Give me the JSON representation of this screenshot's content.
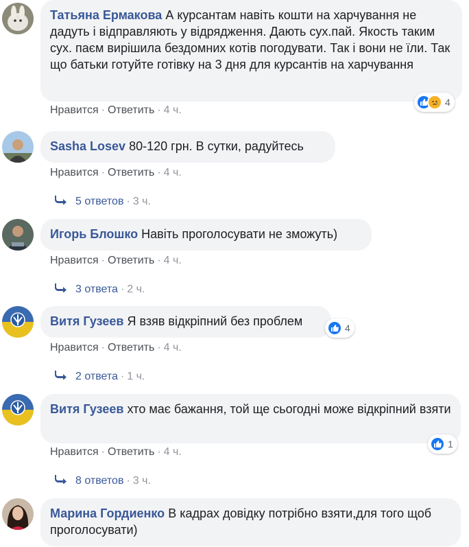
{
  "labels": {
    "like": "Нравится",
    "reply": "Ответить",
    "dot": "·"
  },
  "comments": [
    {
      "author": "Татьяна Ермакова",
      "text": "А курсантам навіть кошти на харчування не дадуть і відправляють у відрядження. Дають сух.пай. Якость таким сух. паєм вирішила бездомних котів погодувати. Так і вони не їли. Так що батьки готуйте готівку на 3 дня для курсантів на харчування",
      "time": "4 ч.",
      "reactions": {
        "icons": [
          "like-icon",
          "sad-icon"
        ],
        "count": "4"
      }
    },
    {
      "author": "Sasha Losev",
      "text": "80-120 грн. В сутки, радуйтесь",
      "time": "4 ч.",
      "replies": {
        "label": "5 ответов",
        "time": "3 ч."
      }
    },
    {
      "author": "Игорь Блошко",
      "text": "Навіть проголосувати не зможуть)",
      "time": "4 ч.",
      "replies": {
        "label": "3 ответа",
        "time": "2 ч."
      }
    },
    {
      "author": "Витя Гузеев",
      "text": "Я взяв відкріпний без проблем",
      "time": "4 ч.",
      "reactions": {
        "icons": [
          "like-icon"
        ],
        "count": "4"
      },
      "replies": {
        "label": "2 ответа",
        "time": "1 ч."
      }
    },
    {
      "author": "Витя Гузеев",
      "text": "хто має бажання, той ще сьогодні може відкріпний взяти",
      "time": "4 ч.",
      "reactions": {
        "icons": [
          "like-icon"
        ],
        "count": "1"
      },
      "replies": {
        "label": "8 ответов",
        "time": "3 ч."
      }
    },
    {
      "author": "Марина Гордиенко",
      "text": "В кадрах довідку потрібно взяти,для того щоб проголосувати)"
    }
  ],
  "colors": {
    "author": "#385898",
    "bubble": "#f2f3f5",
    "meta": "#90949c",
    "like": "#1877f2",
    "sad": "#f7b125"
  }
}
